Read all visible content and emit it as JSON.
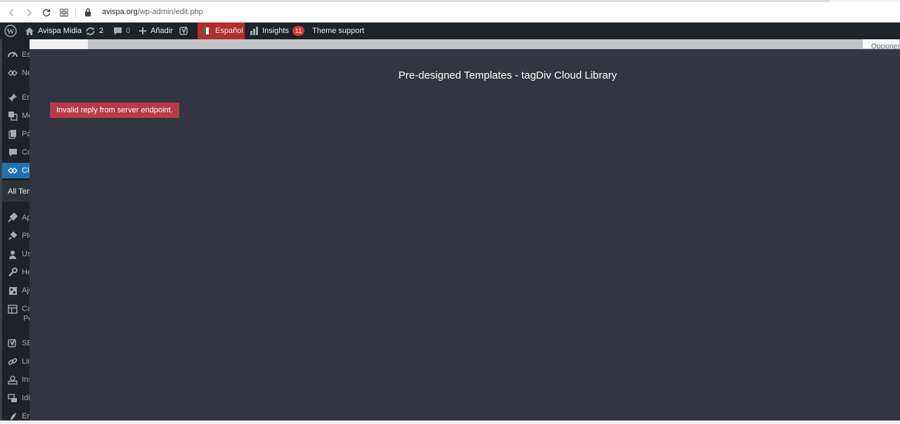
{
  "browser": {
    "url_host": "avispa.org",
    "url_path": "/wp-admin/edit.php",
    "icons": [
      "back-icon",
      "forward-icon",
      "reload-icon",
      "apps-icon",
      "lock-icon"
    ]
  },
  "adminbar": {
    "site_name": "Avispa Midia",
    "updates_count": "2",
    "comments_count": "0",
    "add_label": "Añadir",
    "language_label": "Español",
    "insights_label": "Insights",
    "insights_badge": "11",
    "theme_support_label": "Theme support"
  },
  "sidebar": {
    "items": [
      {
        "label": "Escritorio",
        "icon": "dashboard-icon"
      },
      {
        "label": "Newspaper",
        "icon": "tagdiv-icon"
      },
      {
        "label": "Entradas",
        "icon": "pin-icon"
      },
      {
        "label": "Medios",
        "icon": "media-icon"
      },
      {
        "label": "Páginas",
        "icon": "pages-icon"
      },
      {
        "label": "Comentarios",
        "icon": "comments-icon"
      },
      {
        "label": "Cloud Templates",
        "icon": "tagdiv-icon"
      },
      {
        "label": "All Templates"
      },
      {
        "label": "Apariencia",
        "icon": "appearance-icon"
      },
      {
        "label": "Plugins",
        "icon": "plugins-icon"
      },
      {
        "label": "Usuarios",
        "icon": "users-icon"
      },
      {
        "label": "Herramientas",
        "icon": "tools-icon"
      },
      {
        "label": "Ajustes",
        "icon": "settings-icon"
      },
      {
        "label": "Campos Personalizados",
        "label2": "Pe",
        "icon": "fields-icon"
      },
      {
        "label": "SEO",
        "icon": "yoast-icon"
      },
      {
        "label": "Link Whisper",
        "icon": "link-icon"
      },
      {
        "label": "Insights",
        "icon": "insights-icon"
      },
      {
        "label": "Idiomas",
        "icon": "languages-icon"
      },
      {
        "label": "Envíos",
        "icon": "send-icon"
      }
    ]
  },
  "page": {
    "screen_options_label": "Opciones"
  },
  "modal": {
    "title": "Pre-designed Templates - tagDiv Cloud Library",
    "error_message": "Invalid reply from server endpoint."
  },
  "colors": {
    "adminbar_bg": "#1d2327",
    "modal_bg": "#333542",
    "error_bg": "#b83a46",
    "language_bg": "#b32d2e",
    "active_menu": "#2271b1"
  }
}
